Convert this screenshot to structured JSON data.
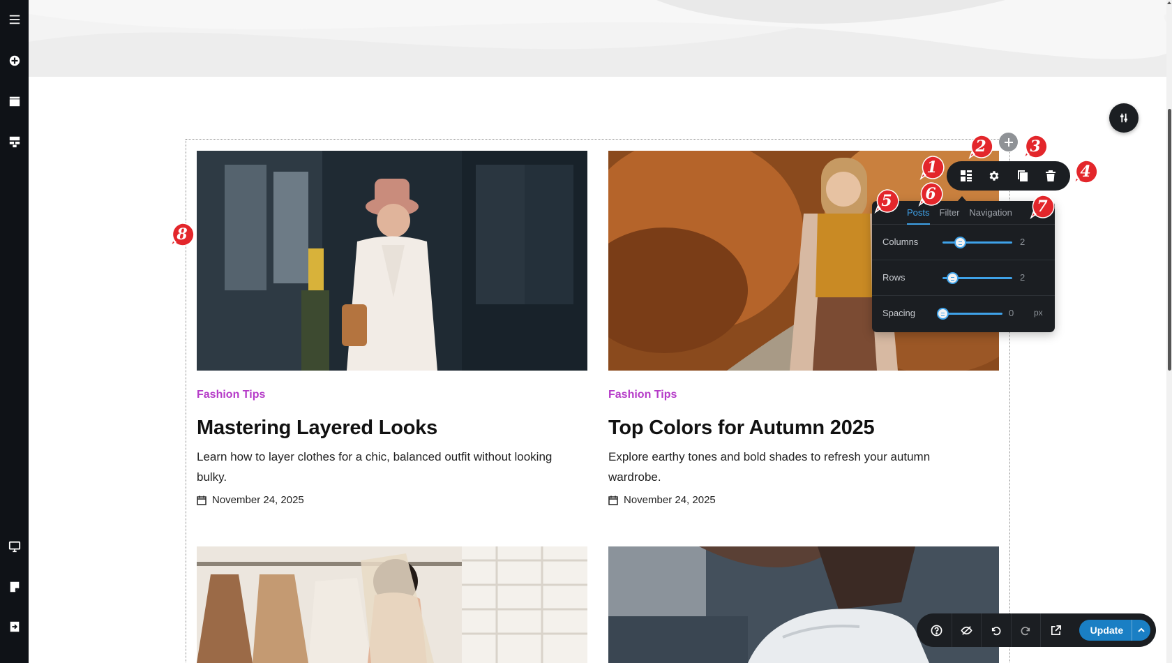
{
  "sidebar": {
    "items": [
      {
        "name": "menu-icon"
      },
      {
        "name": "add-icon"
      },
      {
        "name": "layers-icon"
      },
      {
        "name": "template-icon"
      },
      {
        "name": "desktop-icon"
      },
      {
        "name": "notes-icon"
      },
      {
        "name": "exit-icon"
      }
    ]
  },
  "posts": [
    {
      "category": "Fashion Tips",
      "title": "Mastering Layered Looks",
      "excerpt_line1": "Learn how to layer clothes for a chic, balanced outfit without looking",
      "excerpt_line2": "bulky.",
      "date": "November 24, 2025"
    },
    {
      "category": "Fashion Tips",
      "title": "Top Colors for Autumn 2025",
      "excerpt_line1": "Explore earthy tones and bold shades to refresh your autumn",
      "excerpt_line2": "wardrobe.",
      "date": "November 24, 2025"
    }
  ],
  "panel": {
    "tabs": [
      "Posts",
      "Filter",
      "Navigation"
    ],
    "active_tab": "Posts",
    "settings": [
      {
        "label": "Columns",
        "value": "2",
        "unit": "",
        "level": 0.25
      },
      {
        "label": "Rows",
        "value": "2",
        "unit": "",
        "level": 0.14
      },
      {
        "label": "Spacing",
        "value": "0",
        "unit": "px",
        "level": 0.0
      }
    ]
  },
  "toolbar": {
    "items": [
      "grid-layout-icon",
      "gear-icon",
      "copy-icon",
      "trash-icon"
    ]
  },
  "callouts": [
    "1",
    "2",
    "3",
    "4",
    "5",
    "6",
    "7",
    "8"
  ],
  "bottom_bar": {
    "update_label": "Update",
    "icons": [
      "help-icon",
      "hide-icon",
      "undo-icon",
      "redo-icon",
      "external-link-icon"
    ]
  },
  "colors": {
    "sidebar_bg": "#0f1217",
    "toolbar_bg": "#1b1e22",
    "accent_blue": "#3fa2e8",
    "update_blue": "#1a7fc4",
    "category_purple": "#b53bc8",
    "callout_red": "#e3262b"
  }
}
